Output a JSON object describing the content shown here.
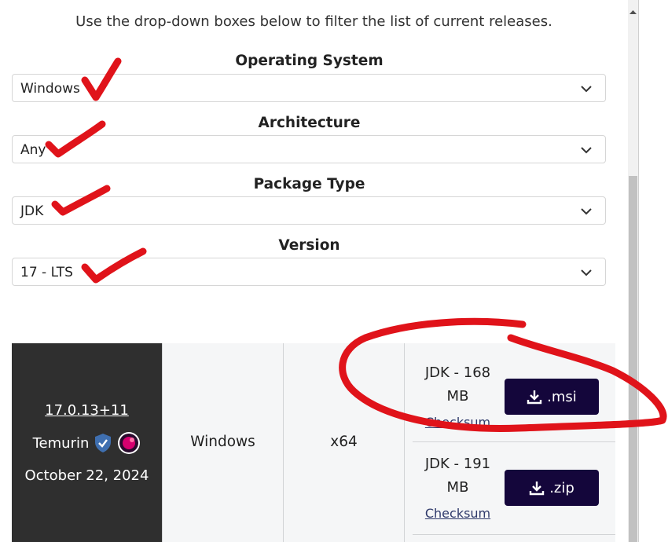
{
  "intro_text": "Use the drop-down boxes below to filter the list of current releases.",
  "filters": [
    {
      "label": "Operating System",
      "value": "Windows"
    },
    {
      "label": "Architecture",
      "value": "Any"
    },
    {
      "label": "Package Type",
      "value": "JDK"
    },
    {
      "label": "Version",
      "value": "17 - LTS"
    }
  ],
  "release": {
    "version": "17.0.13+11",
    "vendor": "Temurin",
    "date": "October 22, 2024",
    "os": "Windows",
    "arch": "x64",
    "packages": [
      {
        "line1": "JDK - 168",
        "line2": "MB",
        "checksum": "Checksum",
        "button": ".msi"
      },
      {
        "line1": "JDK - 191",
        "line2": "MB",
        "checksum": "Checksum",
        "button": ".zip"
      }
    ]
  },
  "colors": {
    "dark_cell": "#2f2f2f",
    "button": "#14063b",
    "annotation": "#e0131a",
    "shield": "#3f6fb0",
    "badge": "#d6006f"
  }
}
